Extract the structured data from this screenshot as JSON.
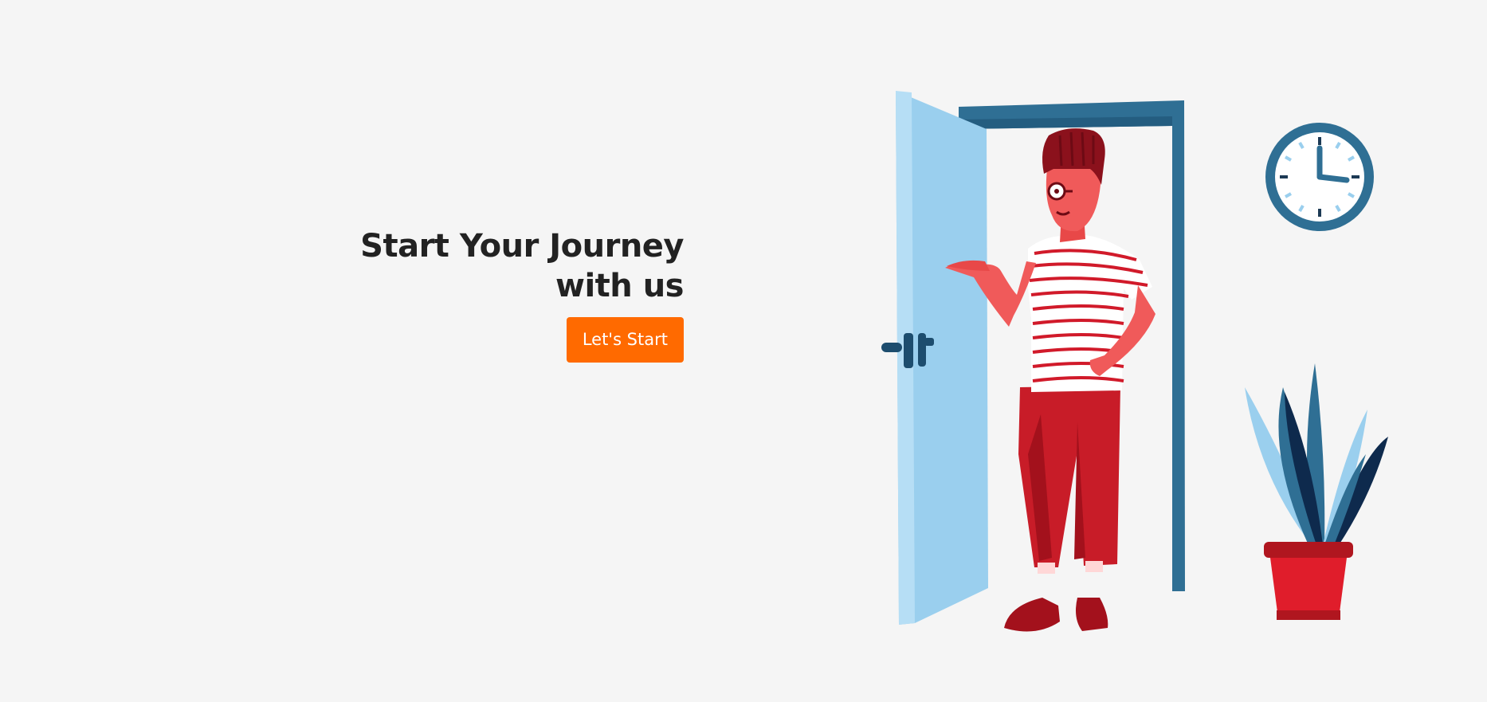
{
  "hero": {
    "title_line1": "Start Your Journey",
    "title_line2": "with us",
    "cta_label": "Let's Start"
  },
  "colors": {
    "background": "#f5f5f5",
    "accent": "#ff6a00",
    "heading": "#222222",
    "door": "#9acfee",
    "frame": "#2f6f94",
    "person_red": "#c81c28"
  },
  "illustration": {
    "icons": [
      "door-icon",
      "person-icon",
      "clock-icon",
      "plant-icon"
    ]
  }
}
